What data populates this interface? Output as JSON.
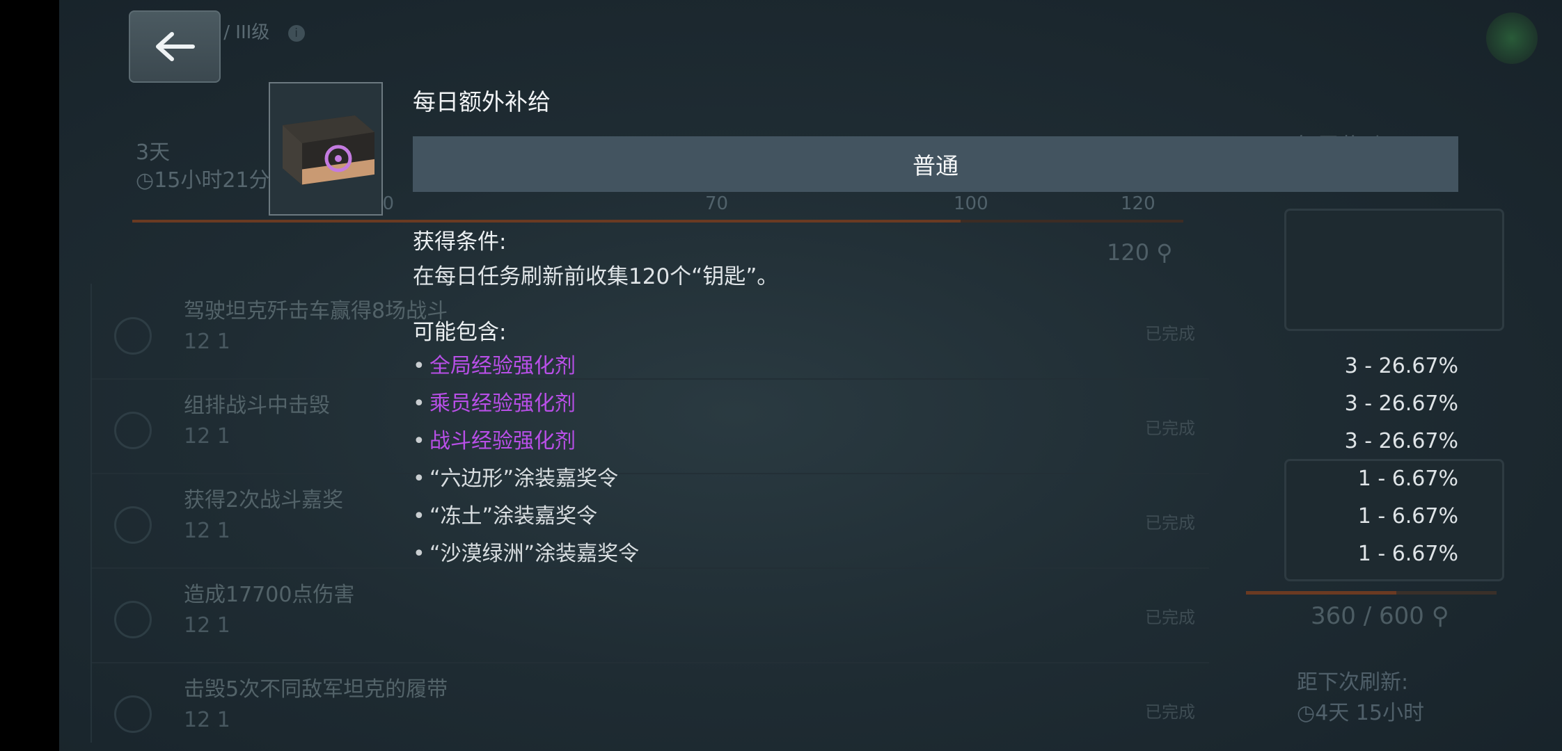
{
  "background": {
    "breadcrumb": "任务 / III级",
    "timer_days": "3天",
    "timer_time": "15小时21分",
    "ticks": [
      "30",
      "70",
      "100",
      "120"
    ],
    "keys_total": "120",
    "tasks": [
      {
        "title": "驾驶坦克歼击车赢得8场战斗",
        "progress": "12  1",
        "state": "已完成"
      },
      {
        "title": "组排战斗中击毁",
        "progress": "12  1",
        "state": "已完成"
      },
      {
        "title": "获得2次战斗嘉奖",
        "progress": "12  1",
        "state": "已完成"
      },
      {
        "title": "造成17700点伤害",
        "progress": "12  1",
        "state": "已完成"
      },
      {
        "title": "击毁5次不同敌军坦克的履带",
        "progress": "12  1",
        "state": "已完成"
      }
    ],
    "reward_header": "每周奖励",
    "progress_value": "360 / 600",
    "progress_fraction": 0.6,
    "refresh_label": "距下次刷新:",
    "refresh_time": "4天 15小时"
  },
  "popup": {
    "title": "每日额外补给",
    "rarity": "普通",
    "condition_header": "获得条件:",
    "condition_text": "在每日任务刷新前收集120个“钥匙”。",
    "contents_header": "可能包含:",
    "items": [
      {
        "name": "全局经验强化剂",
        "chance": "3 - 26.67%",
        "color": "#b94fe8"
      },
      {
        "name": "乘员经验强化剂",
        "chance": "3 - 26.67%",
        "color": "#b94fe8"
      },
      {
        "name": "战斗经验强化剂",
        "chance": "3 - 26.67%",
        "color": "#b94fe8"
      },
      {
        "name": "“六边形”涂装嘉奖令",
        "chance": "1 - 6.67%",
        "color": "#d9dee1"
      },
      {
        "name": "“冻土”涂装嘉奖令",
        "chance": "1 - 6.67%",
        "color": "#d9dee1"
      },
      {
        "name": "“沙漠绿洲”涂装嘉奖令",
        "chance": "1 - 6.67%",
        "color": "#d9dee1"
      }
    ]
  },
  "icons": {
    "back": "arrow-left-icon",
    "chest": "supply-crate-icon",
    "cart": "shopping-cart-icon",
    "clock": "clock-icon",
    "key": "key-icon"
  }
}
